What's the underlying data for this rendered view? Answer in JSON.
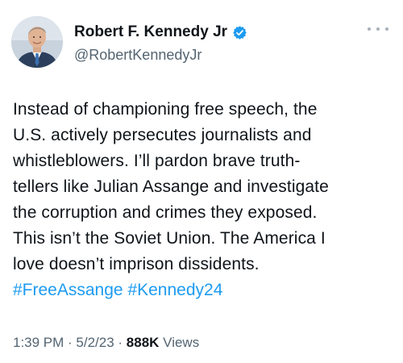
{
  "author": {
    "display_name": "Robert F. Kennedy Jr",
    "handle": "@RobertKennedyJr",
    "verified": true
  },
  "tweet": {
    "text": "Instead of championing free speech, the\nU.S. actively persecutes journalists and\nwhistleblowers. I’ll pardon brave truth-\ntellers like Julian Assange and investigate\nthe corruption and crimes they exposed.\nThis isn’t the Soviet Union. The America I\nlove doesn’t imprison dissidents.",
    "hashtags": [
      "#FreeAssange",
      "#Kennedy24"
    ],
    "time": "1:39 PM",
    "date": "5/2/23",
    "separator": " · ",
    "views_count": "888K",
    "views_label": "Views"
  },
  "icons": {
    "verified": "verified-badge-icon",
    "more": "more-options-icon"
  },
  "colors": {
    "link": "#1d9bf0",
    "secondary_text": "#536471",
    "primary_text": "#0f1419"
  }
}
